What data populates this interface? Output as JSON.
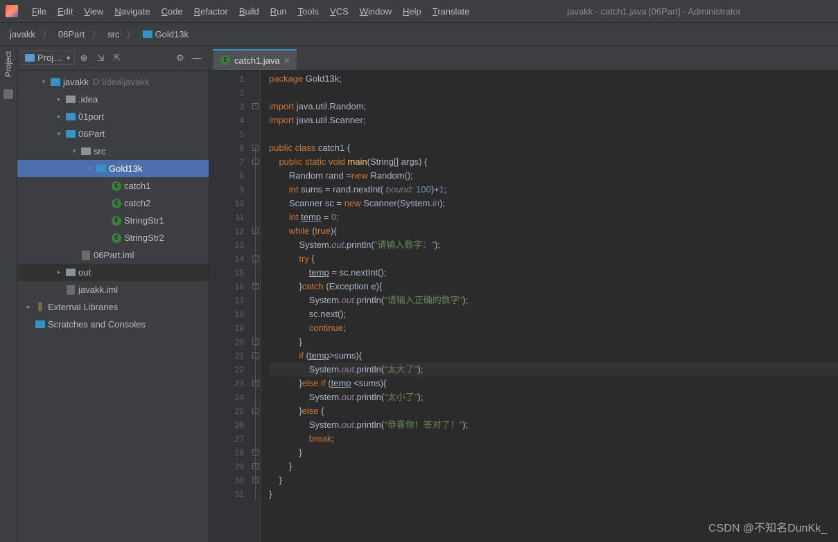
{
  "window_title": "javakk - catch1.java [06Part] - Administrator",
  "menus": [
    "File",
    "Edit",
    "View",
    "Navigate",
    "Code",
    "Refactor",
    "Build",
    "Run",
    "Tools",
    "VCS",
    "Window",
    "Help",
    "Translate"
  ],
  "breadcrumbs": [
    "javakk",
    "06Part",
    "src",
    "Gold13k"
  ],
  "project_panel": {
    "title": "Proj…",
    "icons": {
      "aim": "⊕",
      "collapse": "⇲",
      "expand": "⇱",
      "gear": "⚙",
      "hide": "—"
    }
  },
  "tree": [
    {
      "depth": 0,
      "arrow": "▾",
      "icon": "mod",
      "label": "javakk",
      "hint": "D:\\idea\\javakk"
    },
    {
      "depth": 1,
      "arrow": "▸",
      "icon": "fold",
      "label": ".idea"
    },
    {
      "depth": 1,
      "arrow": "▸",
      "icon": "mod",
      "label": "01port"
    },
    {
      "depth": 1,
      "arrow": "▾",
      "icon": "mod",
      "label": "06Part"
    },
    {
      "depth": 2,
      "arrow": "▾",
      "icon": "fold",
      "label": "src"
    },
    {
      "depth": 3,
      "arrow": "▾",
      "icon": "pkg",
      "label": "Gold13k",
      "selected": true
    },
    {
      "depth": 4,
      "arrow": "",
      "icon": "class",
      "label": "catch1"
    },
    {
      "depth": 4,
      "arrow": "",
      "icon": "class",
      "label": "catch2"
    },
    {
      "depth": 4,
      "arrow": "",
      "icon": "class",
      "label": "StringStr1"
    },
    {
      "depth": 4,
      "arrow": "",
      "icon": "class",
      "label": "StringStr2"
    },
    {
      "depth": 2,
      "arrow": "",
      "icon": "file",
      "label": "06Part.iml"
    },
    {
      "depth": 1,
      "arrow": "▸",
      "icon": "fold",
      "label": "out",
      "hov": true
    },
    {
      "depth": 1,
      "arrow": "",
      "icon": "file",
      "label": "javakk.iml"
    },
    {
      "depth": 0,
      "arrow": "▸",
      "icon": "lib",
      "label": "External Libraries",
      "root": true
    },
    {
      "depth": 0,
      "arrow": "",
      "icon": "scr",
      "label": "Scratches and Consoles",
      "root": true
    }
  ],
  "editor": {
    "tab": "catch1.java",
    "current_line": 22,
    "lines": [
      {
        "n": 1,
        "html": "<span class='kw'>package</span> Gold13k;"
      },
      {
        "n": 2,
        "html": ""
      },
      {
        "n": 3,
        "html": "<span class='kw'>import</span> java.util.Random;"
      },
      {
        "n": 4,
        "html": "<span class='kw'>import</span> java.util.Scanner;"
      },
      {
        "n": 5,
        "html": ""
      },
      {
        "n": 6,
        "html": "<span class='kw'>public class</span> <span class='cls-name'>catch1</span> {",
        "run": true
      },
      {
        "n": 7,
        "html": "    <span class='kw'>public static void</span> <span class='fn'>main</span>(String[] args) {",
        "run": true
      },
      {
        "n": 8,
        "html": "        Random rand =<span class='kw'>new</span> Random();"
      },
      {
        "n": 9,
        "html": "        <span class='kw'>int</span> sums = rand.nextInt( <span class='param'>bound:</span> <span class='num'>100</span>)+<span class='num'>1</span>;"
      },
      {
        "n": 10,
        "html": "        Scanner sc = <span class='kw'>new</span> Scanner(System.<span class='field'>in</span>);"
      },
      {
        "n": 11,
        "html": "        <span class='kw'>int</span> <span class='und'>temp</span> = <span class='num'>0</span>;"
      },
      {
        "n": 12,
        "html": "        <span class='kw'>while</span> (<span class='kw'>true</span>){"
      },
      {
        "n": 13,
        "html": "            System.<span class='field'>out</span>.println(<span class='str'>\"请输入数字：\"</span>);"
      },
      {
        "n": 14,
        "html": "            <span class='kw'>try</span> {"
      },
      {
        "n": 15,
        "html": "                <span class='und'>temp</span> = sc.nextInt();"
      },
      {
        "n": 16,
        "html": "            }<span class='kw'>catch</span> (Exception e){"
      },
      {
        "n": 17,
        "html": "                System.<span class='field'>out</span>.println(<span class='str'>\"请输入正确的数字\"</span>);"
      },
      {
        "n": 18,
        "html": "                sc.next();"
      },
      {
        "n": 19,
        "html": "                <span class='kw'>continue</span>;"
      },
      {
        "n": 20,
        "html": "            }"
      },
      {
        "n": 21,
        "html": "            <span class='kw'>if</span> (<span class='und'>temp</span>&gt;sums){"
      },
      {
        "n": 22,
        "html": "                System.<span class='field'>out</span>.println(<span class='str'>\"太大了\"</span>);",
        "bulb": true,
        "current": true
      },
      {
        "n": 23,
        "html": "            }<span class='kw'>else if</span> (<span class='und'>temp</span> &lt;sums){"
      },
      {
        "n": 24,
        "html": "                System.<span class='field'>out</span>.println(<span class='str'>\"太小了\"</span>);"
      },
      {
        "n": 25,
        "html": "            }<span class='kw'>else</span> {"
      },
      {
        "n": 26,
        "html": "                System.<span class='field'>out</span>.println(<span class='str'>\"恭喜你！答对了！\"</span>);"
      },
      {
        "n": 27,
        "html": "                <span class='kw'>break</span>;"
      },
      {
        "n": 28,
        "html": "            }"
      },
      {
        "n": 29,
        "html": "        }"
      },
      {
        "n": 30,
        "html": "    }"
      },
      {
        "n": 31,
        "html": "}"
      }
    ]
  },
  "watermark": "CSDN @不知名DunKk_"
}
